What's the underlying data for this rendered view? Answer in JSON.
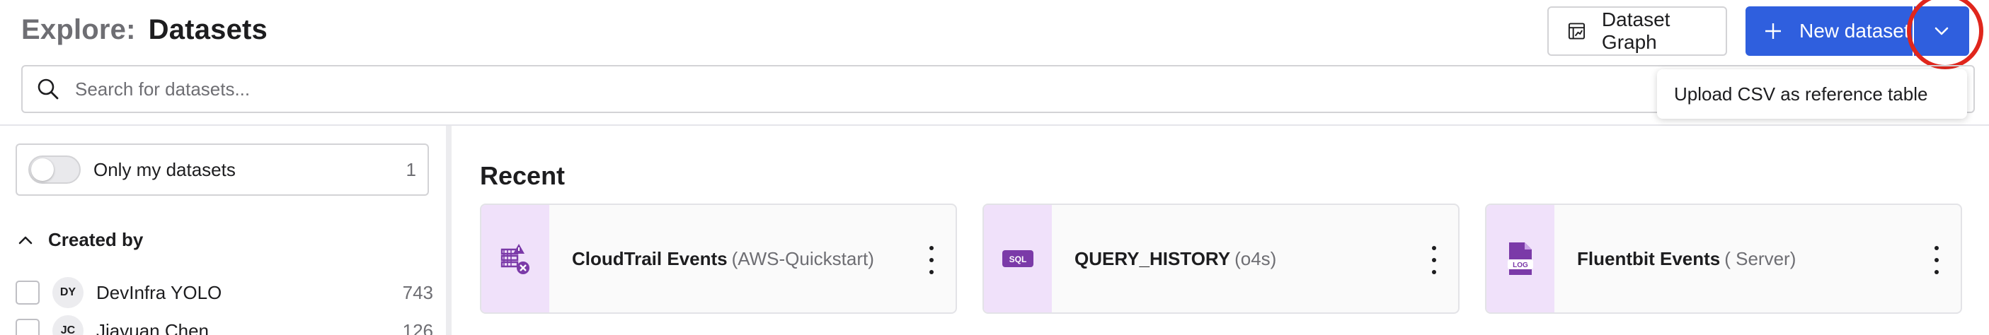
{
  "header": {
    "title_prefix": "Explore:",
    "title": "Datasets",
    "dataset_graph_label": "Dataset Graph",
    "new_dataset_label": "New dataset"
  },
  "search": {
    "placeholder": "Search for datasets...",
    "value": ""
  },
  "dropdown": {
    "items": [
      {
        "label": "Upload CSV as reference table"
      }
    ]
  },
  "sidebar": {
    "only_mine": {
      "label": "Only my datasets",
      "count": "1",
      "enabled": false
    },
    "created_by": {
      "label": "Created by",
      "users": [
        {
          "initials": "DY",
          "name": "DevInfra YOLO",
          "count": "743"
        },
        {
          "initials": "JC",
          "name": "Jiayuan Chen",
          "count": "126"
        }
      ]
    }
  },
  "recent": {
    "title": "Recent",
    "cards": [
      {
        "name": "CloudTrail Events",
        "source": "(AWS-Quickstart)",
        "icon": "cloudtrail-icon"
      },
      {
        "name": "QUERY_HISTORY",
        "source": "(o4s)",
        "icon": "sql-icon",
        "icon_text": "SQL"
      },
      {
        "name": "Fluentbit Events",
        "source": "( Server)",
        "icon": "log-file-icon",
        "icon_text": "LOG"
      }
    ]
  },
  "colors": {
    "primary": "#2f5fde",
    "highlight_ring": "#e0261c",
    "icon_bg": "#f0e1fa",
    "icon_fg": "#7b3aa8"
  }
}
